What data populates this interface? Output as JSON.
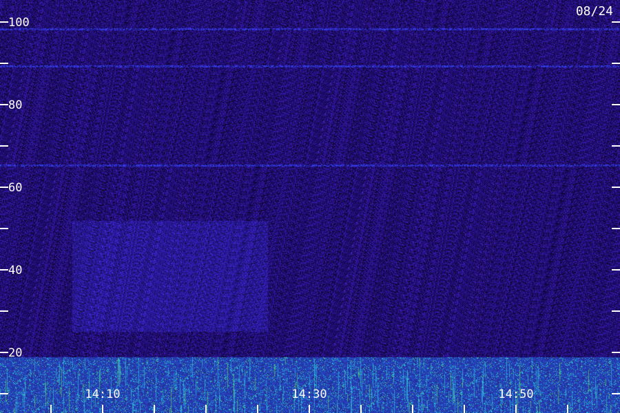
{
  "date_label": "08/24",
  "colors": {
    "background": "#1a0d4a",
    "noise_low": "#2a1580",
    "noise_high": "#3c2bd0",
    "band": "#3a3ad8",
    "streak_cyan": "#30d0e0",
    "streak_green": "#60e060",
    "label": "#ffffff"
  },
  "chart_data": {
    "type": "heatmap",
    "title": "",
    "xlabel": "",
    "ylabel": "",
    "ylim": [
      0,
      100
    ],
    "y_ticks": [
      10,
      20,
      30,
      40,
      50,
      60,
      70,
      80,
      90,
      100
    ],
    "y_tick_labels": [
      {
        "value": 20,
        "label": "20"
      },
      {
        "value": 40,
        "label": "40"
      },
      {
        "value": 60,
        "label": "60"
      },
      {
        "value": 80,
        "label": "80"
      },
      {
        "value": 100,
        "label": "100"
      }
    ],
    "xlim": [
      "14:00",
      "15:00"
    ],
    "x_ticks": [
      "14:00",
      "14:05",
      "14:10",
      "14:15",
      "14:20",
      "14:25",
      "14:30",
      "14:35",
      "14:40",
      "14:45",
      "14:50",
      "14:55"
    ],
    "x_tick_labels": [
      {
        "value": "14:10",
        "label": "14:10"
      },
      {
        "value": "14:30",
        "label": "14:30"
      },
      {
        "value": "14:50",
        "label": "14:50"
      }
    ],
    "features": [
      {
        "kind": "horizontal-line",
        "y": 99
      },
      {
        "kind": "horizontal-line",
        "y": 90
      },
      {
        "kind": "horizontal-line",
        "y": 66
      },
      {
        "kind": "region",
        "y_range": [
          25,
          52
        ],
        "x_range": [
          "14:07",
          "14:26"
        ]
      },
      {
        "kind": "low-band",
        "y_range": [
          0,
          19
        ]
      }
    ]
  }
}
